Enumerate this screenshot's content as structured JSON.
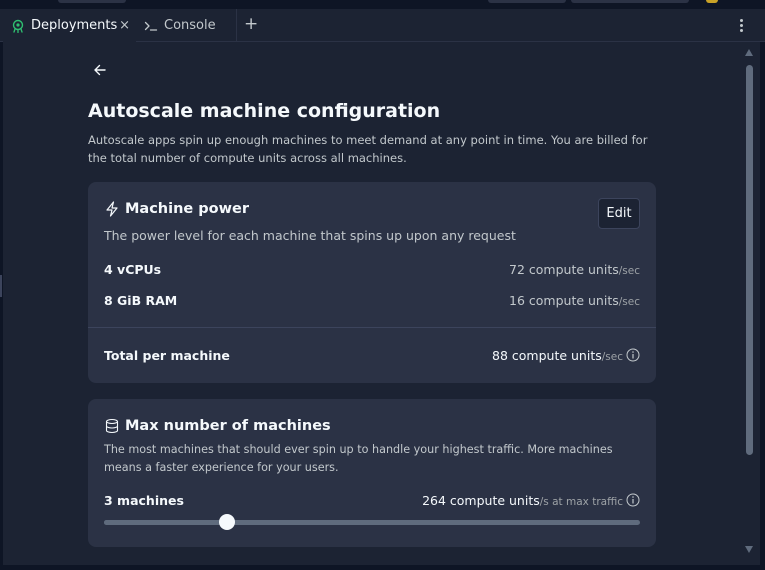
{
  "tabs": [
    {
      "label": "Deployments",
      "icon": "deployments-icon",
      "close": "×"
    },
    {
      "label": "Console",
      "icon": "console-icon"
    }
  ],
  "tab_add": "+",
  "page": {
    "title": "Autoscale machine configuration",
    "description": "Autoscale apps spin up enough machines to meet demand at any point in time. You are billed for the total number of compute units across all machines."
  },
  "machine_power": {
    "title": "Machine power",
    "icon": "lightning-icon",
    "subtitle": "The power level for each machine that spins up upon any request",
    "edit_label": "Edit",
    "rows": [
      {
        "label": "4 vCPUs",
        "value": "72 compute units",
        "unit": "/sec"
      },
      {
        "label": "8 GiB RAM",
        "value": "16 compute units",
        "unit": "/sec"
      }
    ],
    "total": {
      "label": "Total per machine",
      "value": "88 compute units",
      "unit": "/sec"
    }
  },
  "max_machines": {
    "title": "Max number of machines",
    "icon": "database-icon",
    "subtitle": "The most machines that should ever spin up to handle your highest traffic. More machines means a faster experience for your users.",
    "count_label": "3 machines",
    "value": "264 compute units",
    "unit": "/s at max traffic",
    "slider_fraction": 0.23
  },
  "colors": {
    "background": "#1c2333",
    "card": "#2b3245",
    "accent_icon": "#2fbf71"
  }
}
